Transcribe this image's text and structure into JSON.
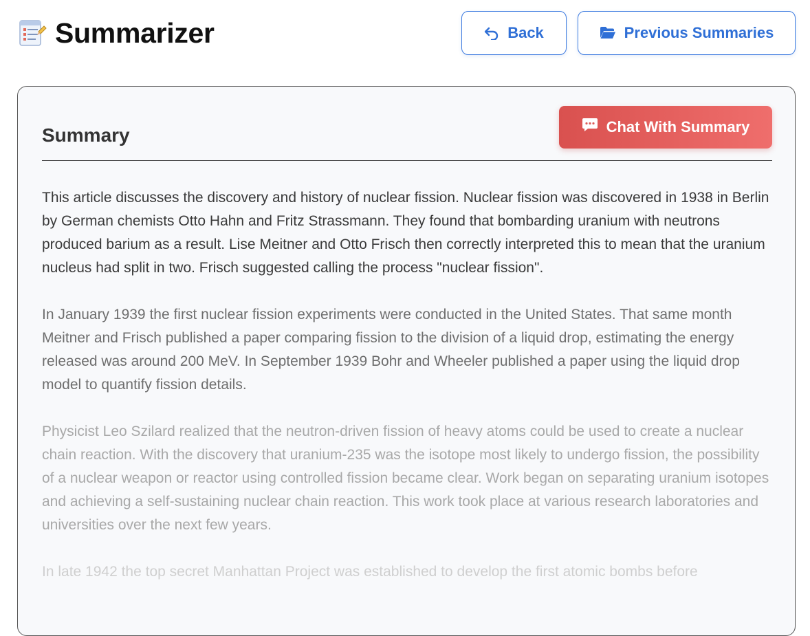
{
  "header": {
    "app_title": "Summarizer",
    "app_icon": "memo-icon",
    "back_label": "Back",
    "back_icon": "undo-arrow-icon",
    "previous_label": "Previous Summaries",
    "previous_icon": "folder-open-icon"
  },
  "card": {
    "title": "Summary",
    "chat_label": "Chat With Summary",
    "chat_icon": "chat-bubble-icon",
    "paragraphs": [
      "This article discusses the discovery and history of nuclear fission. Nuclear fission was discovered in 1938 in Berlin by German chemists Otto Hahn and Fritz Strassmann. They found that bombarding uranium with neutrons produced barium as a result. Lise Meitner and Otto Frisch then correctly interpreted this to mean that the uranium nucleus had split in two. Frisch suggested calling the process \"nuclear fission\".",
      "In January 1939 the first nuclear fission experiments were conducted in the United States. That same month Meitner and Frisch published a paper comparing fission to the division of a liquid drop, estimating the energy released was around 200 MeV. In September 1939 Bohr and Wheeler published a paper using the liquid drop model to quantify fission details.",
      "Physicist Leo Szilard realized that the neutron-driven fission of heavy atoms could be used to create a nuclear chain reaction. With the discovery that uranium-235 was the isotope most likely to undergo fission, the possibility of a nuclear weapon or reactor using controlled fission became clear. Work began on separating uranium isotopes and achieving a self-sustaining nuclear chain reaction. This work took place at various research laboratories and universities over the next few years.",
      "In late 1942 the top secret Manhattan Project was established to develop the first atomic bombs before"
    ]
  },
  "colors": {
    "accent_blue": "#2f6fd6",
    "chat_red_start": "#d9514f",
    "chat_red_end": "#ef6e6c"
  }
}
